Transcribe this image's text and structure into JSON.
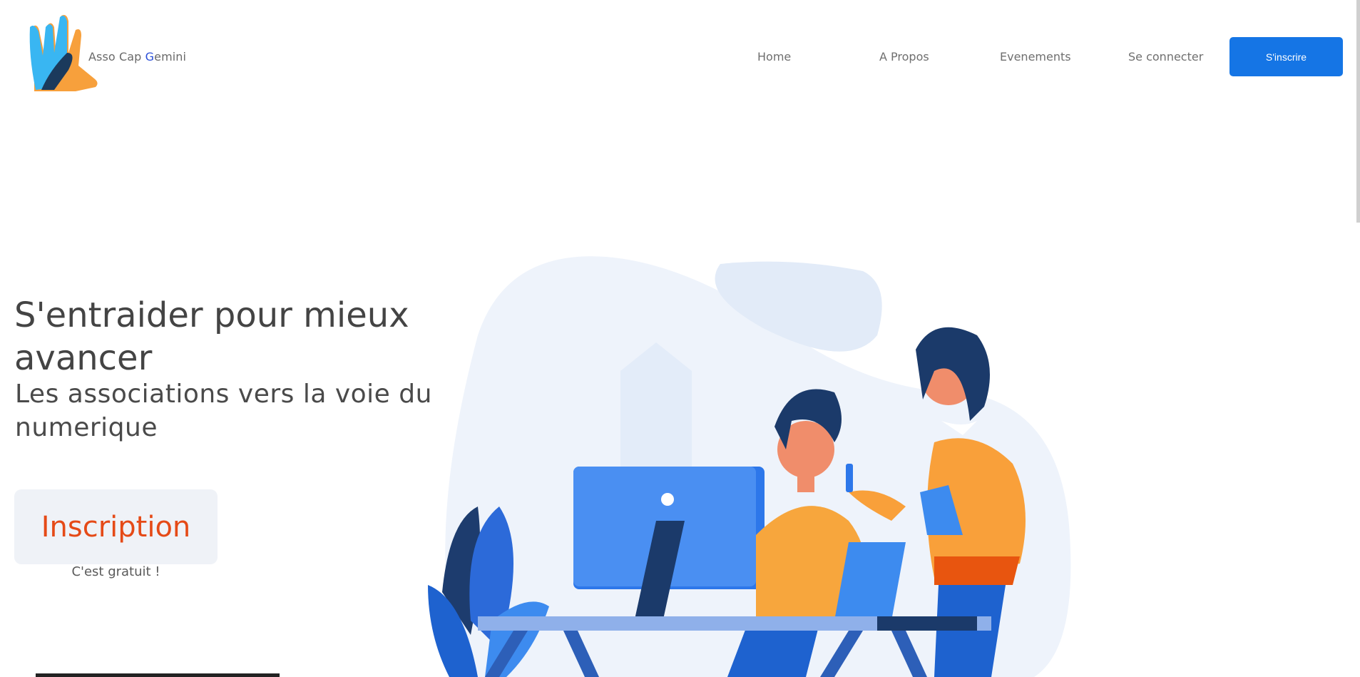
{
  "header": {
    "brand_prefix": "Asso Cap ",
    "brand_g": "G",
    "brand_suffix": "emini",
    "nav": {
      "home": "Home",
      "about": "A Propos",
      "events": "Evenements",
      "login": "Se connecter",
      "signup": "S'inscrire"
    }
  },
  "hero": {
    "title": "S'entraider pour mieux avancer",
    "subtitle": "Les associations vers la voie du numerique",
    "cta_label": "Inscription",
    "cta_note": "C'est gratuit !"
  },
  "colors": {
    "primary": "#1575e5",
    "accent": "#e54a17",
    "cta_bg": "#eff2f7",
    "text": "#444444"
  },
  "icons": {
    "logo": "hand-logo-icon",
    "illustration": "office-workers-illustration"
  }
}
